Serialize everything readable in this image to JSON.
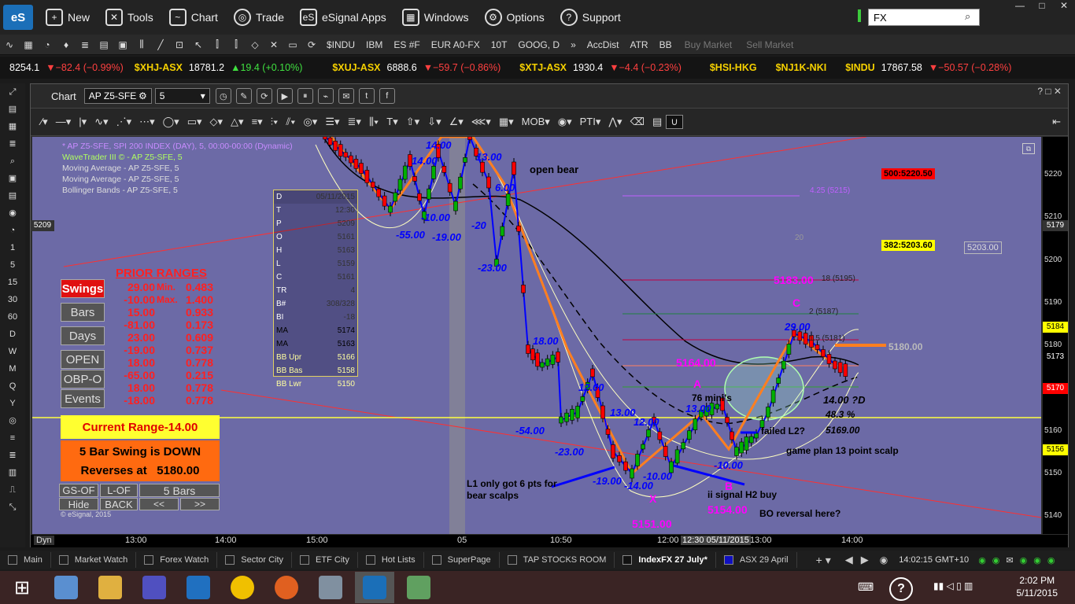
{
  "menubar": {
    "logo": "eS",
    "items": [
      {
        "label": "New",
        "icon": "new-window-icon"
      },
      {
        "label": "Tools",
        "icon": "tools-icon"
      },
      {
        "label": "Chart",
        "icon": "chart-icon"
      },
      {
        "label": "Trade",
        "icon": "globe-icon"
      },
      {
        "label": "eSignal Apps",
        "icon": "apps-icon"
      },
      {
        "label": "Windows",
        "icon": "windows-icon"
      },
      {
        "label": "Options",
        "icon": "gear-icon"
      },
      {
        "label": "Support",
        "icon": "help-icon"
      }
    ],
    "search_value": "FX"
  },
  "toolbar_symbols": [
    "$INDU",
    "IBM",
    "ES #F",
    "EUR A0-FX",
    "10T",
    "GOOG, D",
    "»",
    "AccDist",
    "ATR",
    "BB",
    "Buy Market",
    "Sell Market"
  ],
  "ticker": {
    "lead": "8254.1",
    "lead_chg": "▼−82.4 (−0.99%)",
    "items": [
      {
        "sym": "$XHJ-ASX",
        "last": "18781.2",
        "chg": "▲19.4 (+0.10%)",
        "up": true
      },
      {
        "sym": "$XUJ-ASX",
        "last": "6888.6",
        "chg": "▼−59.7 (−0.86%)",
        "up": false
      },
      {
        "sym": "$XTJ-ASX",
        "last": "1930.4",
        "chg": "▼−4.4 (−0.23%)",
        "up": false
      },
      {
        "sym": "$HSI-HKG",
        "last": "",
        "chg": "",
        "up": false
      },
      {
        "sym": "$NJ1K-NKI",
        "last": "",
        "chg": "",
        "up": false
      },
      {
        "sym": "$INDU",
        "last": "17867.58",
        "chg": "▼−50.57 (−0.28%)",
        "up": false
      }
    ]
  },
  "side_intervals": [
    "1",
    "5",
    "15",
    "30",
    "60",
    "D",
    "W",
    "M",
    "Q",
    "Y"
  ],
  "chart_window": {
    "title": "Chart",
    "symbol": "AP Z5-SFE",
    "interval": "5",
    "dyn": "Dyn",
    "copyright": "© eSignal, 2015"
  },
  "legend": [
    {
      "text": "* AP Z5-SFE, SPI 200 INDEX (DAY), 5, 00:00-00:00 (Dynamic)",
      "color": "#c88cff"
    },
    {
      "text": "WaveTrader III © - AP Z5-SFE, 5",
      "color": "#b0ff60"
    },
    {
      "text": "Moving Average - AP Z5-SFE, 5",
      "color": "#ddd"
    },
    {
      "text": "Moving Average - AP Z5-SFE, 5",
      "color": "#ddd"
    },
    {
      "text": "Bollinger Bands - AP Z5-SFE, 5",
      "color": "#ddd"
    }
  ],
  "data_window": {
    "header_left": "D",
    "header_right": "05/11/2015",
    "rows": [
      {
        "k": "T",
        "v": "12:30"
      },
      {
        "k": "P",
        "v": "5209"
      },
      {
        "k": "O",
        "v": "5161"
      },
      {
        "k": "H",
        "v": "5163"
      },
      {
        "k": "L",
        "v": "5159"
      },
      {
        "k": "C",
        "v": "5161"
      },
      {
        "k": "TR",
        "v": "4"
      },
      {
        "k": "B#",
        "v": "308/328"
      },
      {
        "k": "BI",
        "v": "-18"
      },
      {
        "k": "MA",
        "v": "5174"
      },
      {
        "k": "MA",
        "v": "5163"
      },
      {
        "k": "BB Upr",
        "v": "5166"
      },
      {
        "k": "BB Bas",
        "v": "5158"
      },
      {
        "k": "BB Lwr",
        "v": "5150"
      }
    ]
  },
  "prior_ranges": {
    "title": "PRIOR RANGES",
    "buttons": [
      "Swings",
      "Bars",
      "Days",
      "OPEN",
      "OBP-O",
      "Events"
    ],
    "col1": [
      "29.00",
      "-10.00",
      "15.00",
      "-81.00",
      "23.00",
      "-19.00",
      "18.00",
      "-65.00",
      "18.00",
      "-18.00"
    ],
    "mid": [
      "",
      "Min.",
      "",
      "Max.",
      "",
      "",
      "",
      "",
      "",
      ""
    ],
    "col2": [
      "0.483",
      "1.400",
      "0.933",
      "0.173",
      "0.609",
      "0.737",
      "0.778",
      "0.215",
      "0.778",
      "0.778"
    ],
    "current_label": "Current Range",
    "current_value": "-14.00",
    "swing_text": "5 Bar Swing is DOWN",
    "reverses_text": "Reverses at",
    "reverses_value": "5180.00",
    "bottom_buttons": [
      "GS-OF",
      "L-OF",
      "5 Bars",
      "Hide",
      "BACK",
      "<<",
      ">>"
    ]
  },
  "y_ticks": [
    "5220",
    "5210",
    "5200",
    "5190",
    "5180",
    "5170",
    "5160",
    "5150",
    "5140"
  ],
  "y_flags": [
    {
      "v": "5209",
      "bg": "#333",
      "fg": "#fff"
    },
    {
      "v": "5179",
      "bg": "#ffff00",
      "fg": "#000"
    },
    {
      "v": "5184",
      "bg": "#ffff00",
      "fg": "#000"
    },
    {
      "v": "5173",
      "bg": "#000",
      "fg": "#fff"
    },
    {
      "v": "5170",
      "bg": "#ff0000",
      "fg": "#fff"
    },
    {
      "v": "5156",
      "bg": "#ffff00",
      "fg": "#000"
    }
  ],
  "x_ticks": [
    "13:00",
    "14:00",
    "15:00",
    "05",
    "10:50",
    "12:00",
    "12:30 05/11/2015",
    "13:00",
    "14:00"
  ],
  "annotations": {
    "open_bear": "open bear",
    "fib_500": "500:5220.50",
    "fib_382": "382:5203.60",
    "box_5203": "5203.00",
    "fib_425": "4.25 (5215)",
    "fib_20": "20",
    "level_5183": "5183.00",
    "fib_18": "18 (5195)",
    "fib_c": "C",
    "fib_2": "2 (5187)",
    "fib_15": "1.5 (5181)",
    "level_5180": "5180.00",
    "level_5164": "5164.00",
    "label_a": "A",
    "minis": "76 mini's",
    "q_d": "14.00 ?D",
    "pct": "48.3 %",
    "v_5169": "5169.00",
    "failed_l2": "failed L2?",
    "game_plan": "game plan 13  point scalp",
    "label_b": "B",
    "ii_signal": "ii signal H2 buy",
    "bo_rev": "BO reversal here?",
    "l1_note": "L1 only got 6 pts for bear scalps",
    "label_x": "X",
    "level_5151": "5151.00",
    "level_5154": "5154.00",
    "swing_labels": [
      "14.00",
      "14.00",
      "13.00",
      "6.00",
      "-55.00",
      "-10.00",
      "-19.00",
      "-20",
      "-23.00",
      "18.00",
      "-54.00",
      "12.00",
      "-23.00",
      "13.00",
      "12.00",
      "-19.00",
      "-14.00",
      "-10.00",
      "13.00",
      "-10.00",
      "29.00"
    ]
  },
  "bottom_tabs": [
    "Main",
    "Market Watch",
    "Forex Watch",
    "Sector City",
    "ETF City",
    "Hot Lists",
    "SuperPage",
    "TAP STOCKS ROOM",
    "IndexFX 27 July*",
    "ASX 29 April"
  ],
  "status_time": "14:02:15 GMT+10",
  "taskbar_clock": {
    "time": "2:02 PM",
    "date": "5/11/2015"
  },
  "colors": {
    "plot_bg": "#6c6aa6",
    "accent_orange": "#ff7f20",
    "swing_blue": "#0000ff",
    "bar_red": "#ff0000",
    "bar_green": "#00b000"
  }
}
